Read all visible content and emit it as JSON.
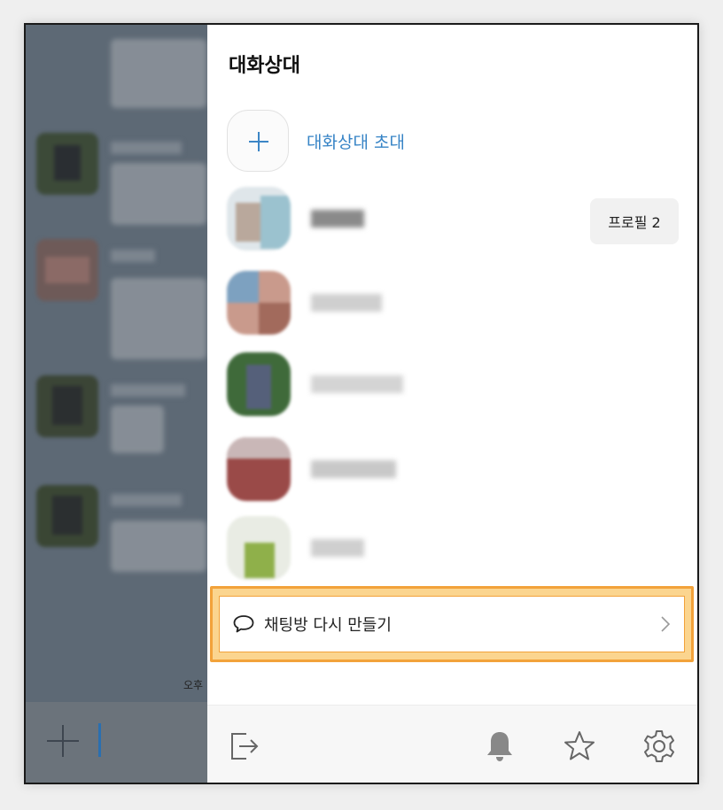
{
  "drawer": {
    "title": "대화상대",
    "invite_label": "대화상대 초대",
    "profile_button_label": "프로필 2",
    "remake_chat_label": "채팅방 다시 만들기"
  },
  "chat": {
    "time_fragment": "오후"
  },
  "colors": {
    "accent_blue": "#3784c6",
    "highlight_border": "#f2a23a",
    "highlight_fill": "#fbd58f"
  },
  "icons": {
    "invite": "plus-icon",
    "remake": "speech-bubble-icon",
    "remake_chevron": "chevron-right-icon",
    "exit": "exit-icon",
    "notifications": "bell-icon",
    "favorite": "star-icon",
    "settings": "gear-icon",
    "chat_attach": "plus-icon"
  }
}
